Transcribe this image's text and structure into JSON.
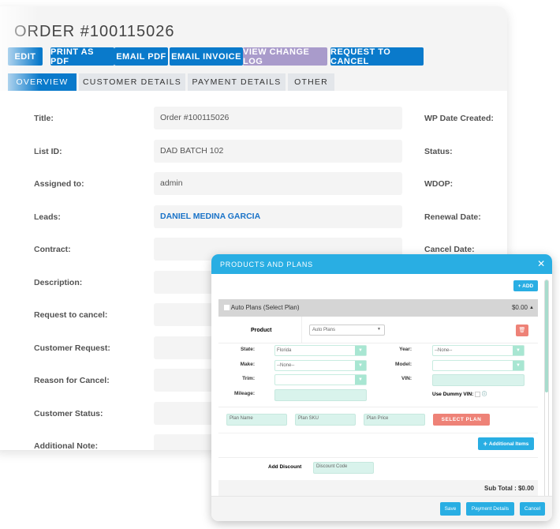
{
  "order": {
    "title": "ORDER #100115026",
    "actions": [
      {
        "label": "EDIT",
        "color": "#0a7acb"
      },
      {
        "label": "PRINT AS PDF",
        "color": "#0a7acb"
      },
      {
        "label": "EMAIL PDF",
        "color": "#0a7acb"
      },
      {
        "label": "EMAIL INVOICE",
        "color": "#0a7acb"
      },
      {
        "label": "VIEW CHANGE LOG",
        "color": "#a99bcb"
      },
      {
        "label": "REQUEST TO CANCEL",
        "color": "#0a7acb"
      }
    ],
    "tabs": [
      "OVERVIEW",
      "CUSTOMER DETAILS",
      "PAYMENT DETAILS",
      "OTHER"
    ],
    "active_tab": "OVERVIEW",
    "fields": [
      {
        "label": "Title:",
        "value": "Order #100115026"
      },
      {
        "label": "List ID:",
        "value": "DAD BATCH 102"
      },
      {
        "label": "Assigned to:",
        "value": "admin"
      },
      {
        "label": "Leads:",
        "value": "DANIEL MEDINA GARCIA"
      },
      {
        "label": "Contract:",
        "value": ""
      },
      {
        "label": "Description:",
        "value": ""
      },
      {
        "label": "Request to cancel:",
        "value": ""
      },
      {
        "label": "Customer Request:",
        "value": ""
      },
      {
        "label": "Reason for Cancel:",
        "value": ""
      },
      {
        "label": "Customer Status:",
        "value": ""
      },
      {
        "label": "Additional Note:",
        "value": ""
      }
    ],
    "right_fields": [
      "WP Date Created:",
      "Status:",
      "WDOP:",
      "Renewal Date:",
      "Cancel Date:"
    ]
  },
  "modal": {
    "title": "PRODUCTS AND PLANS",
    "add": "+ ADD",
    "section": "Auto Plans (Select Plan)",
    "section_price": "$0.00",
    "product_label": "Product",
    "product_value": "Auto Plans",
    "state_label": "State:",
    "state": "Florida",
    "year_label": "Year:",
    "year": "--None--",
    "make_label": "Make:",
    "make": "--None--",
    "model_label": "Model:",
    "model": "",
    "trim_label": "Trim:",
    "trim": "",
    "vin_label": "VIN:",
    "vin": "",
    "mileage_label": "Mileage:",
    "dummy_vin": "Use Dummy VIN:",
    "plan_name_ph": "Plan Name",
    "plan_sku_ph": "Plan SKU",
    "plan_price_ph": "Plan Price",
    "select_plan": "SELECT PLAN",
    "additional_items": "Additional Items",
    "discount_label": "Add Discount",
    "discount_ph": "Discount Code",
    "subtotal": "Sub Total : $0.00",
    "save": "Save",
    "payment_details": "Payment Details",
    "cancel": "Cancel"
  }
}
